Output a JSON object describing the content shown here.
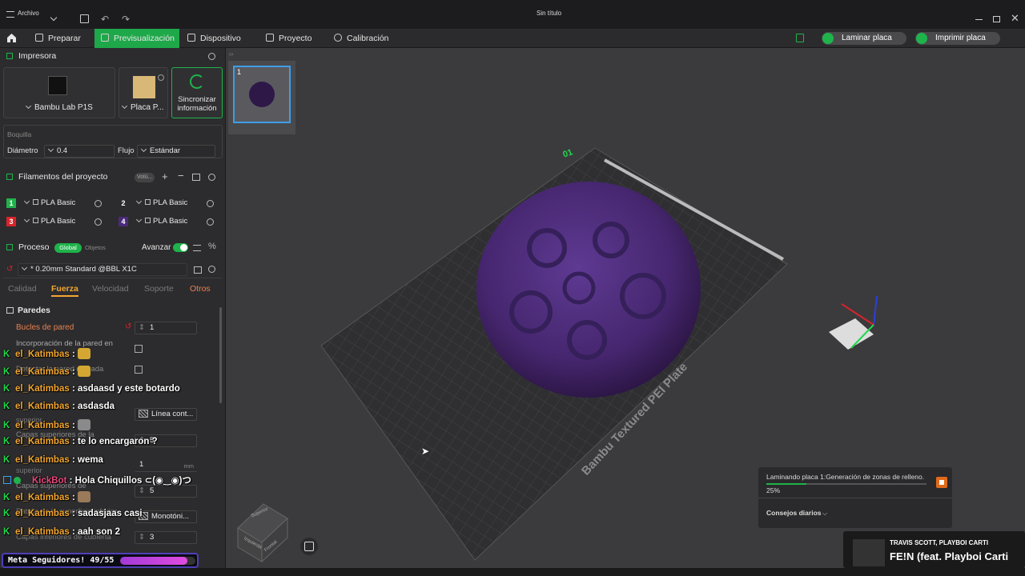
{
  "titlebar": {
    "file_menu": "Archivo",
    "title": "Sin título"
  },
  "nav": {
    "tabs": [
      {
        "label": "Preparar"
      },
      {
        "label": "Previsualización",
        "active": true
      },
      {
        "label": "Dispositivo"
      },
      {
        "label": "Proyecto"
      },
      {
        "label": "Calibración"
      }
    ],
    "slice_button": "Laminar placa",
    "print_button": "Imprimir placa"
  },
  "printer": {
    "section_title": "Impresora",
    "model": "Bambu Lab P1S",
    "plate": "Placa P...",
    "sync_label_1": "Sincronizar",
    "sync_label_2": "información"
  },
  "nozzle": {
    "title": "Boquilla",
    "diameter_label": "Diámetro",
    "diameter_value": "0.4",
    "flow_label": "Flujo",
    "flow_value": "Estándar"
  },
  "filaments": {
    "section_title": "Filamentos del proyecto",
    "vol_tag": "Volú...",
    "items": [
      {
        "num": "1",
        "name": "PLA Basic",
        "color": "#1fb34b"
      },
      {
        "num": "2",
        "name": "PLA Basic",
        "color": "#2c2c2e"
      },
      {
        "num": "3",
        "name": "PLA Basic",
        "color": "#d8232a"
      },
      {
        "num": "4",
        "name": "PLA Basic",
        "color": "#4a2a7a"
      }
    ]
  },
  "process": {
    "section_title": "Proceso",
    "global_tag": "Global",
    "objects_tag": "Objetos",
    "advanced_label": "Avanzar",
    "profile": "* 0.20mm Standard @BBL X1C",
    "tabs": [
      "Calidad",
      "Fuerza",
      "Velocidad",
      "Soporte",
      "Otros"
    ],
    "walls_title": "Paredes",
    "wall_loops_label": "Bucles de pared",
    "wall_loops_value": "1",
    "embed_label": "Incorporación de la pared en",
    "thin_label": "Detectar la pared delgada",
    "top_pattern_value": "Línea cont...",
    "top_layers_label": "Capas superiores de la",
    "top_layers_value": "5",
    "top_thickness_value": "1",
    "top_thickness_unit": "mm",
    "bottom_layers_label": "Capas superiores de",
    "bottom_layers_value": "5",
    "bottom_pattern_label": "Patrón de la superficie inferior",
    "bottom_pattern_value": "Monotóni...",
    "bottom_shell_label": "Capas inferiores de cubierta",
    "bottom_shell_value": "3",
    "misc_label_1": "superior",
    "misc_label_2": "superior"
  },
  "chat": {
    "messages": [
      {
        "user": "el_Katimbas",
        "text": ":",
        "emoji": "#d4a733"
      },
      {
        "user": "el_Katimbas",
        "text": ":",
        "emoji": "#d4a733"
      },
      {
        "user": "el_Katimbas",
        "text": ": asdaasd y este botardo"
      },
      {
        "user": "el_Katimbas",
        "text": ": asdasda"
      },
      {
        "user": "el_Katimbas",
        "text": ":",
        "emoji": "#8a8a8a"
      },
      {
        "user": "el_Katimbas",
        "text": ": te lo encargaron ?"
      },
      {
        "user": "el_Katimbas",
        "text": ": wema"
      },
      {
        "user": "KickBot",
        "text": ": Hola Chiquillos ⊂(◉‿◉)つ",
        "bot": true
      },
      {
        "user": "el_Katimbas",
        "text": ":",
        "emoji": "#9a7a5a"
      },
      {
        "user": "el_Katimbas",
        "text": ": sadasjaas casi"
      },
      {
        "user": "el_Katimbas",
        "text": ": aah son 2"
      }
    ],
    "goal": "Meta Seguidores! 49/55",
    "goal_progress": 0.891
  },
  "viewport": {
    "plate_thumb_number": "1",
    "plate_number": "01",
    "plate_name": "Bambu Textured PEI Plate",
    "cube_top": "Superior",
    "cube_front": "Frontal",
    "cube_left": "Izquierda",
    "model_color": "#4a2a78"
  },
  "progress": {
    "status": "Laminando placa 1:Generación de zonas de relleno.",
    "percent": "25%",
    "value": 0.25,
    "tips": "Consejos diarios"
  },
  "music": {
    "artist": "TRAVIS SCOTT, PLAYBOI CARTI",
    "track": "FE!N (feat. Playboi Carti"
  }
}
